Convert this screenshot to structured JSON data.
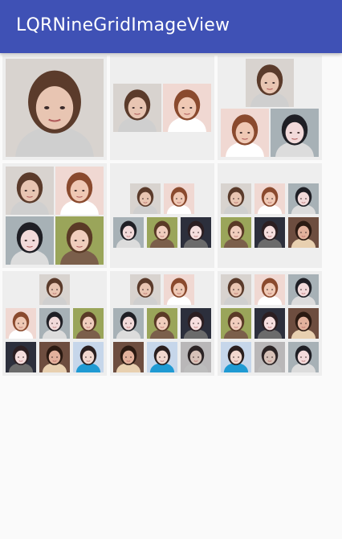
{
  "app": {
    "title": "LQRNineGridImageView"
  },
  "photos": {
    "girl1": {
      "bg": "#d8d3cf",
      "hair": "#5b3b2b",
      "skin": "#e8c5b2",
      "top": "#cfcfcf"
    },
    "girl2": {
      "bg": "#f0d8d2",
      "hair": "#8a4a2e",
      "skin": "#efc8b4",
      "top": "#ffffff"
    },
    "girl3": {
      "bg": "#a7b1b6",
      "hair": "#1f1f25",
      "skin": "#f2dada",
      "top": "#dcdcdc"
    },
    "girl4": {
      "bg": "#9aa55a",
      "hair": "#5a3a26",
      "skin": "#f0cdbd",
      "top": "#7b5f4b"
    },
    "girl5": {
      "bg": "#2c2f3c",
      "hair": "#2c1f22",
      "skin": "#f5dede",
      "top": "#6b6b6b"
    },
    "girl6": {
      "bg": "#6d4d3f",
      "hair": "#2b1a12",
      "skin": "#e2b19c",
      "top": "#e8d0b0"
    },
    "girl7": {
      "bg": "#c6d6ea",
      "hair": "#2a1f1f",
      "skin": "#f2d8cf",
      "top": "#1f9ad3"
    },
    "girl8": {
      "bg": "#b9b7b8",
      "hair": "#2c2425",
      "skin": "#d7c2b8",
      "top": "#bdbdbd"
    }
  },
  "grids": [
    {
      "count": 1
    },
    {
      "count": 2
    },
    {
      "count": 3
    },
    {
      "count": 4
    },
    {
      "count": 5
    },
    {
      "count": 6
    },
    {
      "count": 7
    },
    {
      "count": 8
    },
    {
      "count": 9
    }
  ]
}
